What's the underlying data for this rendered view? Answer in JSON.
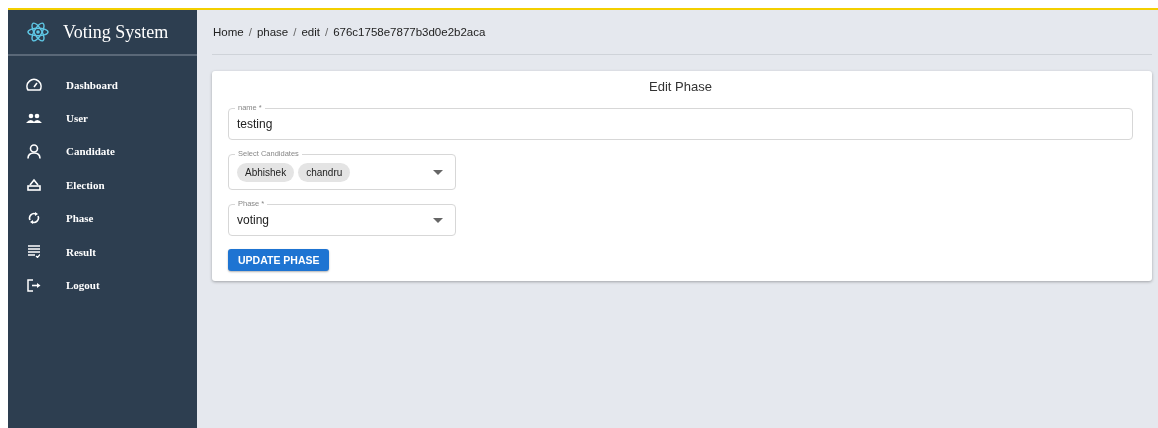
{
  "sidebar": {
    "title": "Voting System",
    "items": [
      {
        "label": "Dashboard"
      },
      {
        "label": "User"
      },
      {
        "label": "Candidate"
      },
      {
        "label": "Election"
      },
      {
        "label": "Phase"
      },
      {
        "label": "Result"
      },
      {
        "label": "Logout"
      }
    ]
  },
  "breadcrumb": {
    "separator": "/",
    "items": [
      "Home",
      "phase",
      "edit",
      "676c1758e7877b3d0e2b2aca"
    ]
  },
  "form": {
    "title": "Edit Phase",
    "name_field": {
      "label": "name *",
      "value": "testing"
    },
    "candidates_field": {
      "label": "Select Candidates",
      "chips": [
        "Abhishek",
        "chandru"
      ]
    },
    "phase_field": {
      "label": "Phase *",
      "value": "voting"
    },
    "submit": "UPDATE PHASE"
  }
}
